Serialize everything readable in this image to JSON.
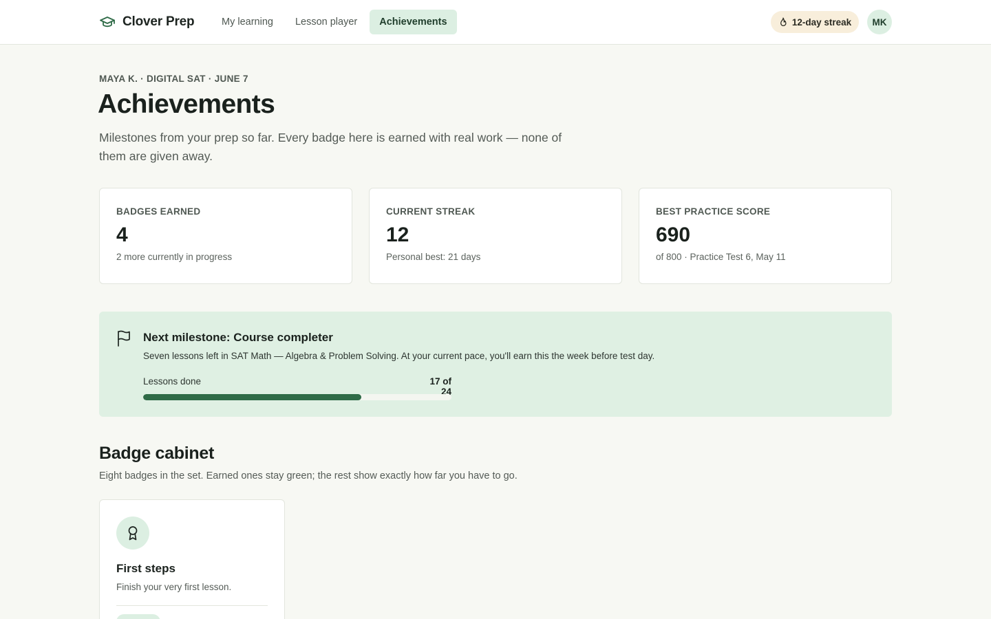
{
  "app": {
    "brand_name": "Clover Prep",
    "brand_icon": "graduation-cap-icon"
  },
  "nav": {
    "tabs": [
      {
        "label": "My learning",
        "active": false
      },
      {
        "label": "Lesson player",
        "active": false
      },
      {
        "label": "Achievements",
        "active": true
      }
    ]
  },
  "header": {
    "streak_label": "12-day streak",
    "streak_icon": "flame-icon",
    "avatar_initials": "MK"
  },
  "page": {
    "eyebrow": "MAYA K. · DIGITAL SAT · JUNE 7",
    "title": "Achievements",
    "description": "Milestones from your prep so far. Every badge here is earned with real work — none of them are given away."
  },
  "stats": [
    {
      "label": "BADGES EARNED",
      "value": "4",
      "note": "2 more currently in progress"
    },
    {
      "label": "CURRENT STREAK",
      "value": "12",
      "note": "Personal best: 21 days"
    },
    {
      "label": "BEST PRACTICE SCORE",
      "value": "690",
      "note": "of 800 · Practice Test 6, May 11"
    }
  ],
  "milestone": {
    "icon": "flag-icon",
    "title": "Next milestone: Course completer",
    "description": "Seven lessons left in SAT Math — Algebra & Problem Solving. At your current pace, you'll earn this the week before test day.",
    "progress_label": "Lessons done",
    "progress_count": "17 of 24",
    "progress_done": 17,
    "progress_total": 24
  },
  "badge_cabinet": {
    "title": "Badge cabinet",
    "description": "Eight badges in the set. Earned ones stay green; the rest show exactly how far you have to go.",
    "badges": [
      {
        "title": "First steps",
        "description": "Finish your very first lesson.",
        "icon": "award-ribbon-icon",
        "earned": true
      }
    ]
  },
  "colors": {
    "accent_green": "#2f6b47",
    "tint_green": "#dcefe2",
    "streak_tint": "#f8eedb",
    "page_bg": "#f7f8f3"
  }
}
